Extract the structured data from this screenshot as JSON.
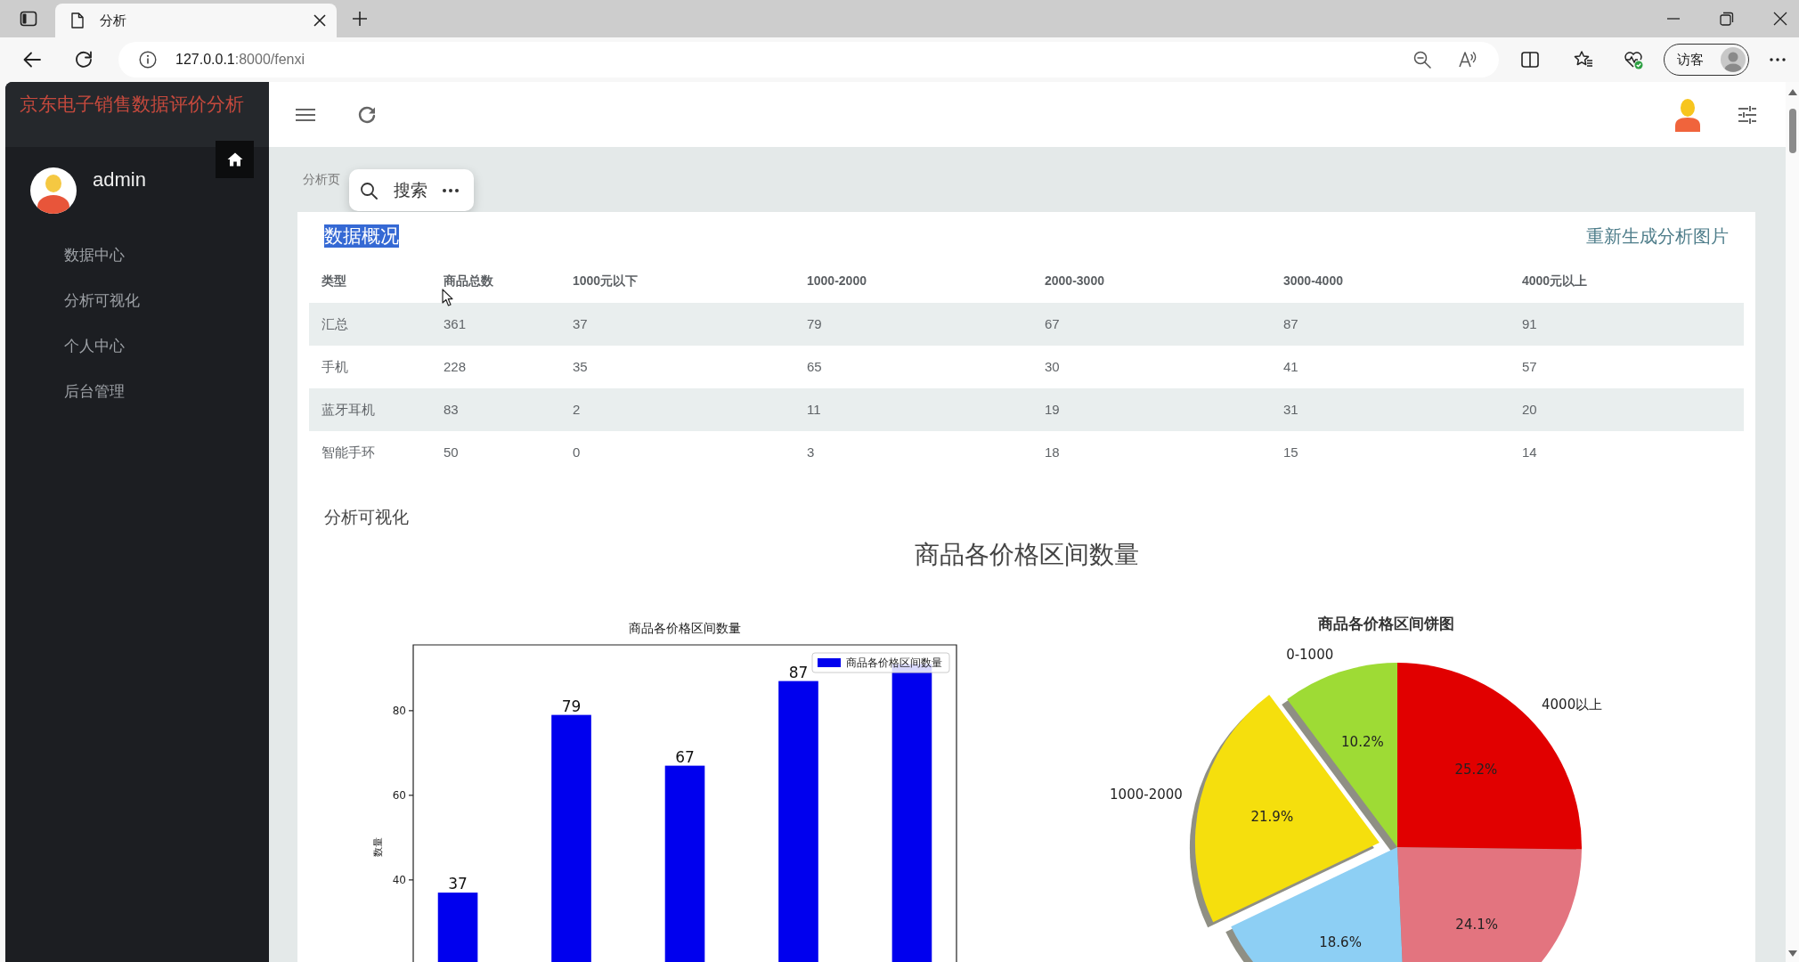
{
  "browser": {
    "tab": {
      "title": "分析"
    },
    "address": {
      "host": "127.0.0.1",
      "path": ":8000/fenxi"
    },
    "profile": {
      "label": "访客"
    }
  },
  "sidebar": {
    "title": "京东电子销售数据评价分析",
    "user": {
      "name": "admin"
    },
    "items": [
      {
        "label": "数据中心",
        "selected": false
      },
      {
        "label": "分析可视化",
        "selected": false
      },
      {
        "label": "个人中心",
        "selected": false
      },
      {
        "label": "后台管理",
        "selected": false
      }
    ]
  },
  "breadcrumb": {
    "text": "分析页"
  },
  "search_popup": {
    "label": "搜索"
  },
  "overview": {
    "title": "数据概况",
    "highlighted": true,
    "action": "重新生成分析图片",
    "table": {
      "columns": [
        "类型",
        "商品总数",
        "1000元以下",
        "1000-2000",
        "2000-3000",
        "3000-4000",
        "4000元以上"
      ],
      "rows": [
        [
          "汇总",
          "361",
          "37",
          "79",
          "67",
          "87",
          "91"
        ],
        [
          "手机",
          "228",
          "35",
          "65",
          "30",
          "41",
          "57"
        ],
        [
          "蓝牙耳机",
          "83",
          "2",
          "11",
          "19",
          "31",
          "20"
        ],
        [
          "智能手环",
          "50",
          "0",
          "3",
          "18",
          "15",
          "14"
        ]
      ]
    }
  },
  "visualization": {
    "title": "分析可视化",
    "heading": "商品各价格区间数量",
    "charts": [
      {
        "chart_data": {
          "type": "bar",
          "title": "商品各价格区间数量",
          "ylabel": "数量",
          "series": [
            {
              "name": "商品各价格区间数量",
              "color": "#0000ee",
              "values": [
                37,
                79,
                67,
                87,
                91
              ]
            }
          ],
          "ylim": [
            20.6,
            95.55
          ],
          "yticks": [
            40,
            60,
            80
          ],
          "value_labels": [
            "37",
            "79",
            "67",
            "87",
            null
          ]
        }
      },
      {
        "chart_data": {
          "type": "pie",
          "title": "商品各价格区间饼图",
          "categories": [
            "0-1000",
            "1000-2000",
            null,
            null,
            "4000以上"
          ],
          "values": [
            10.2,
            21.9,
            18.6,
            24.1,
            25.2
          ],
          "colors": [
            "#9edb35",
            "#f5df0d",
            "#8dcff4",
            "#e3747f",
            "#e10000"
          ],
          "value_labels": [
            "10.2%",
            "21.9%",
            "18.6%",
            "24.1%",
            "25.2%"
          ]
        }
      }
    ]
  }
}
